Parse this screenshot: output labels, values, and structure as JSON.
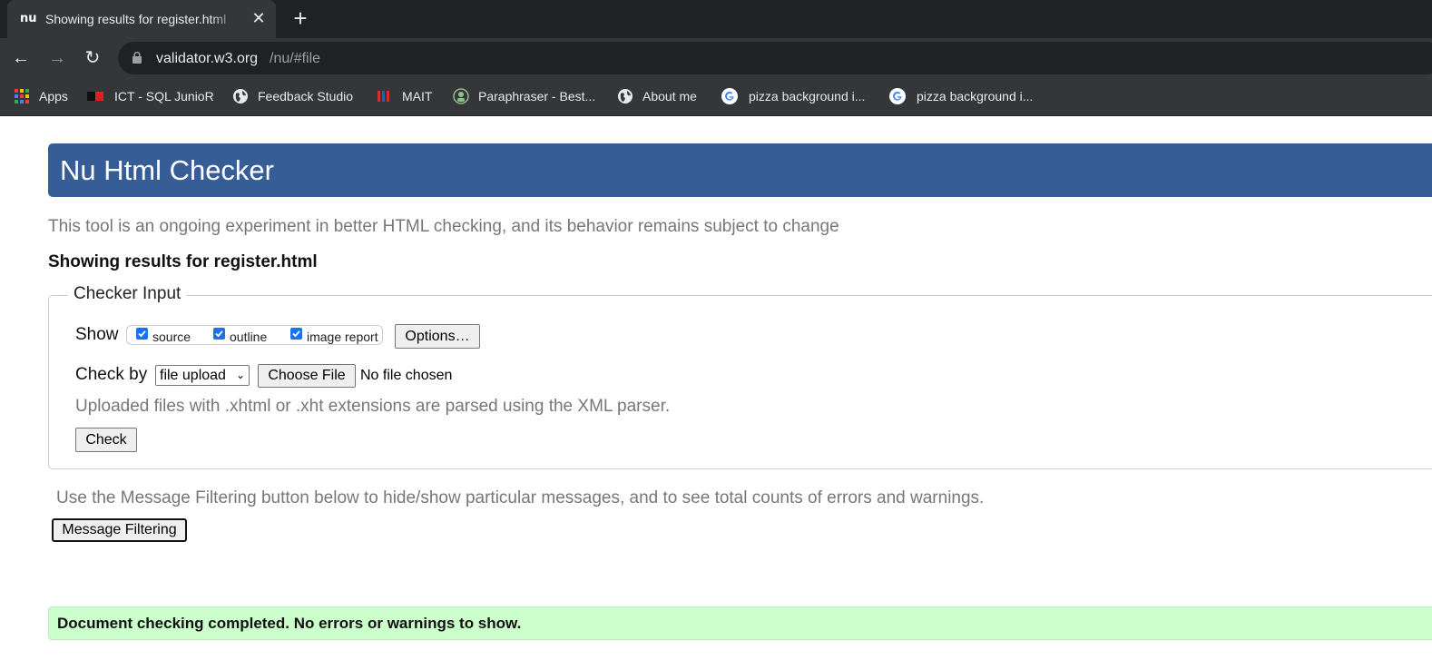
{
  "browser": {
    "tab": {
      "favicon_text": "nu",
      "title": "Showing results for register.html",
      "close": "✕"
    },
    "new_tab": "+",
    "nav": {
      "back": "←",
      "forward": "→",
      "reload": "↻"
    },
    "url": {
      "host": "validator.w3.org",
      "path": "/nu/#file"
    },
    "bookmarks": [
      {
        "label": "Apps",
        "icon": "apps-grid-icon"
      },
      {
        "label": "ICT - SQL JunioR",
        "icon": "ict-icon"
      },
      {
        "label": "Feedback Studio",
        "icon": "globe-icon"
      },
      {
        "label": "MAIT",
        "icon": "mait-icon"
      },
      {
        "label": "Paraphraser - Best...",
        "icon": "paraphraser-icon"
      },
      {
        "label": "About me",
        "icon": "globe-icon"
      },
      {
        "label": "pizza background i...",
        "icon": "google-icon"
      },
      {
        "label": "pizza background i...",
        "icon": "google-icon"
      }
    ]
  },
  "page": {
    "banner_title": "Nu Html Checker",
    "intro": "This tool is an ongoing experiment in better HTML checking, and its behavior remains subject to change",
    "results_heading": "Showing results for register.html",
    "checker_input": {
      "legend": "Checker Input",
      "show_label": "Show",
      "show_options": [
        {
          "label": "source",
          "checked": true
        },
        {
          "label": "outline",
          "checked": true
        },
        {
          "label": "image report",
          "checked": true
        }
      ],
      "options_button": "Options…",
      "check_by_label": "Check by",
      "check_by_value": "file upload",
      "choose_file_button": "Choose File",
      "no_file_text": "No file chosen",
      "xml_note": "Uploaded files with .xhtml or .xht extensions are parsed using the XML parser.",
      "check_button": "Check"
    },
    "filter_note": "Use the Message Filtering button below to hide/show particular messages, and to see total counts of errors and warnings.",
    "filter_button": "Message Filtering",
    "success_message": "Document checking completed. No errors or warnings to show."
  },
  "colors": {
    "banner": "#365d95",
    "success_bg": "#ccffcc",
    "checkbox": "#1a73e8",
    "chrome_dark": "#202124",
    "chrome_toolbar": "#35363a"
  }
}
